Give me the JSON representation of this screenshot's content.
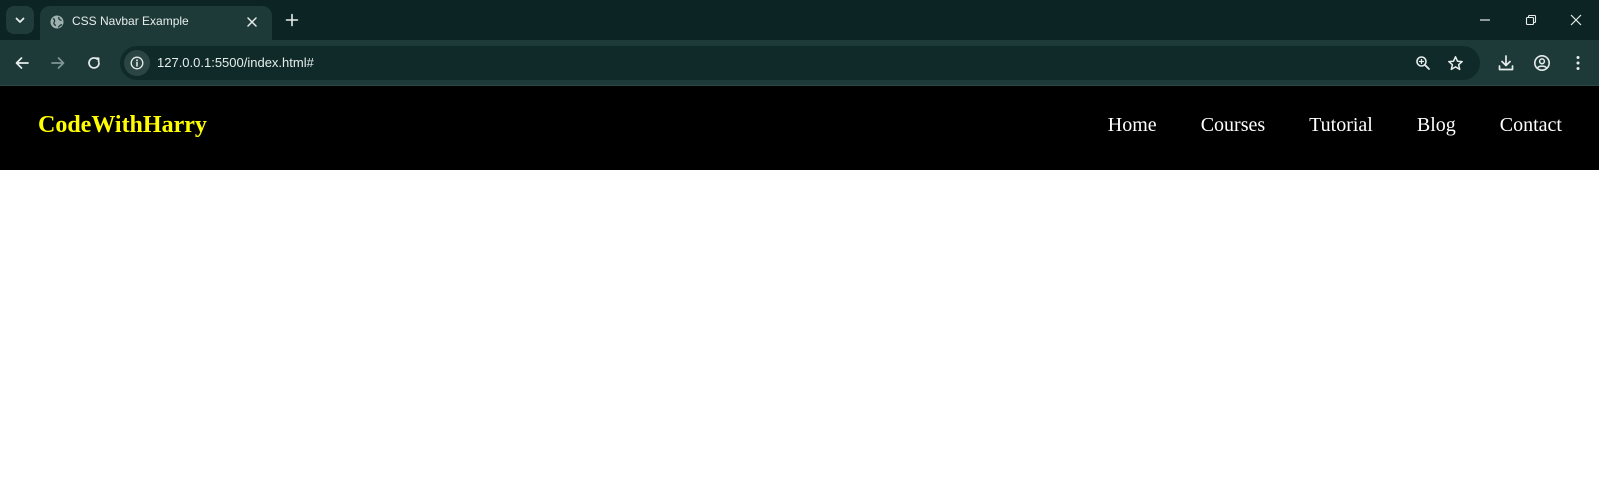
{
  "browser": {
    "tab": {
      "title": "CSS Navbar Example"
    },
    "address_bar": {
      "url": "127.0.0.1:5500/index.html#"
    },
    "icons": {
      "tab_search": "chevron-down-icon",
      "favicon": "globe-icon",
      "tab_close": "close-icon",
      "new_tab": "plus-icon",
      "minimize": "minimize-icon",
      "restore": "restore-icon",
      "window_close": "close-icon",
      "back": "arrow-left-icon",
      "forward": "arrow-right-icon",
      "reload": "reload-icon",
      "site_info": "info-icon",
      "zoom": "zoom-icon",
      "bookmark": "star-icon",
      "download": "download-icon",
      "profile": "profile-icon",
      "menu": "kebab-menu-icon"
    },
    "colors": {
      "tabstrip": "#0c2524",
      "toolbar": "#1e3a38",
      "omnibox": "#0f2a29"
    }
  },
  "page": {
    "navbar": {
      "logo": "CodeWithHarry",
      "links": [
        {
          "label": "Home"
        },
        {
          "label": "Courses"
        },
        {
          "label": "Tutorial"
        },
        {
          "label": "Blog"
        },
        {
          "label": "Contact"
        }
      ]
    },
    "colors": {
      "navbar_background": "#000000",
      "logo": "#ffff00",
      "link": "#ffffff",
      "body_background": "#ffffff"
    }
  }
}
